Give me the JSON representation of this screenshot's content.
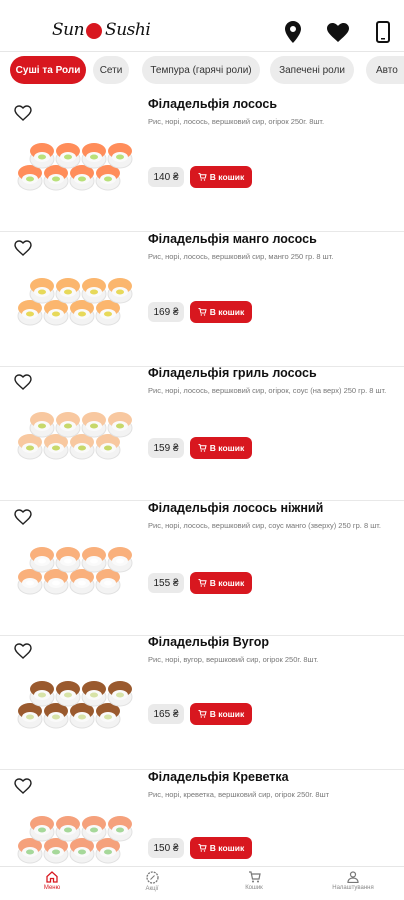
{
  "header": {
    "logo_left": "Sun",
    "logo_right": "Sushi"
  },
  "icons": {
    "location": "location-pin-icon",
    "favorites": "heart-icon",
    "phone": "phone-icon"
  },
  "colors": {
    "accent": "#d8171f",
    "chip_bg": "#ececec",
    "price_bg": "#eaeaea"
  },
  "categories": [
    {
      "label": "Суші та Роли",
      "active": true
    },
    {
      "label": "Сети",
      "active": false
    },
    {
      "label": "Темпура (гарячі роли)",
      "active": false
    },
    {
      "label": "Запечені роли",
      "active": false
    },
    {
      "label": "Авто",
      "active": false
    }
  ],
  "cart_label": "В кошик",
  "products": [
    {
      "name": "Філадельфія лосось",
      "desc": "Рис, норі, лосось, вершковий сир, огірок 250г. 8шт.",
      "price": "140 ₴"
    },
    {
      "name": "Філадельфія манго лосось",
      "desc": "Рис, норі, лосось, вершковий сир, манго 250 гр. 8 шт.",
      "price": "169 ₴"
    },
    {
      "name": "Філадельфія гриль лосось",
      "desc": "Рис, норі, лосось, вершковий сир, огірок, соус (на верх) 250 гр. 8 шт.",
      "price": "159 ₴"
    },
    {
      "name": "Філадельфія лосось ніжний",
      "desc": "Рис, норі, лосось, вершковий сир, соус манго (зверху) 250 гр. 8 шт.",
      "price": "155 ₴"
    },
    {
      "name": "Філадельфія Вугор",
      "desc": "Рис, норі, вугор, вершковий сир, огірок 250г. 8шт.",
      "price": "165 ₴"
    },
    {
      "name": "Філадельфія Креветка",
      "desc": "Рис, норі, креветка, вершковий сир, огірок 250г. 8шт",
      "price": "150 ₴"
    }
  ],
  "bottom_nav": [
    {
      "label": "Меню",
      "icon": "home-icon",
      "active": true
    },
    {
      "label": "Акції",
      "icon": "percent-badge-icon",
      "active": false
    },
    {
      "label": "Кошик",
      "icon": "cart-icon",
      "active": false
    },
    {
      "label": "Налаштування",
      "icon": "user-icon",
      "active": false
    }
  ]
}
